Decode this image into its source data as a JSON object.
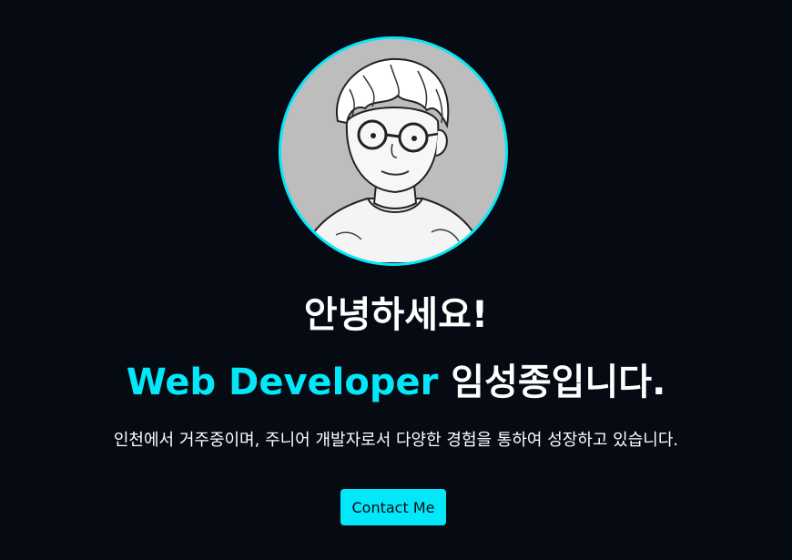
{
  "home": {
    "avatar_alt": "Illustrated profile portrait",
    "greeting": "안녕하세요!",
    "intro_highlight": "Web Developer",
    "intro_rest": " 임성종입니다.",
    "description": "인천에서 거주중이며, 주니어 개발자로서 다양한 경험을 통하여 성장하고 있습니다.",
    "contact_label": "Contact Me"
  },
  "colors": {
    "background": "#050a13",
    "accent": "#03e8f9",
    "text": "#ffffff",
    "avatar_bg": "#bdbdbd"
  }
}
